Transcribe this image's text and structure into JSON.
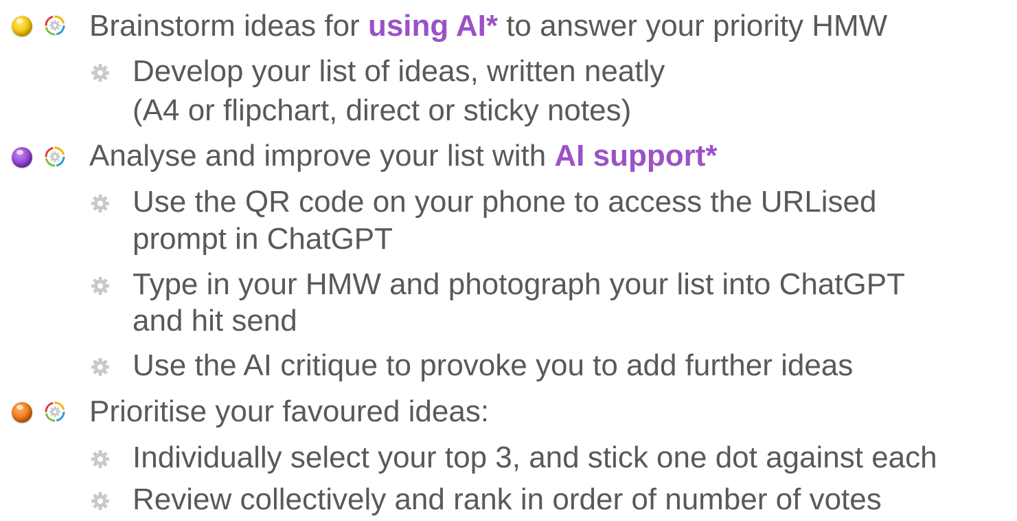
{
  "colors": {
    "text": "#595959",
    "highlight": "#9B51C8",
    "bullet_gear": "#BFBFBF",
    "dot_yellow": "#F2C200",
    "dot_purple": "#8E3BD1",
    "dot_orange": "#E8700F"
  },
  "icons": {
    "status_dot": "circle",
    "step_icon": "gear-ring-icon",
    "sub_bullet": "gear-icon"
  },
  "step1": {
    "pre": "Brainstorm ideas for ",
    "highlight": "using AI*",
    "post": " to answer your priority HMW",
    "dot_color": "yellow",
    "sub1_line1": "Develop your list of ideas, written neatly",
    "sub1_line2": "(A4 or flipchart, direct or sticky notes)"
  },
  "step2": {
    "pre": "Analyse and improve your list with ",
    "highlight": "AI support*",
    "dot_color": "purple",
    "sub1_line1": "Use the QR code on your phone to access the URLised",
    "sub1_line2": "prompt in ChatGPT",
    "sub2_line1": "Type in your HMW and photograph your list into ChatGPT",
    "sub2_line2": "and hit send",
    "sub3": "Use the AI critique to provoke you to add further ideas"
  },
  "step3": {
    "text": "Prioritise your favoured ideas:",
    "dot_color": "orange",
    "sub1": "Individually select your top 3, and stick one dot against each",
    "sub2": "Review collectively and rank in order of number of votes"
  }
}
